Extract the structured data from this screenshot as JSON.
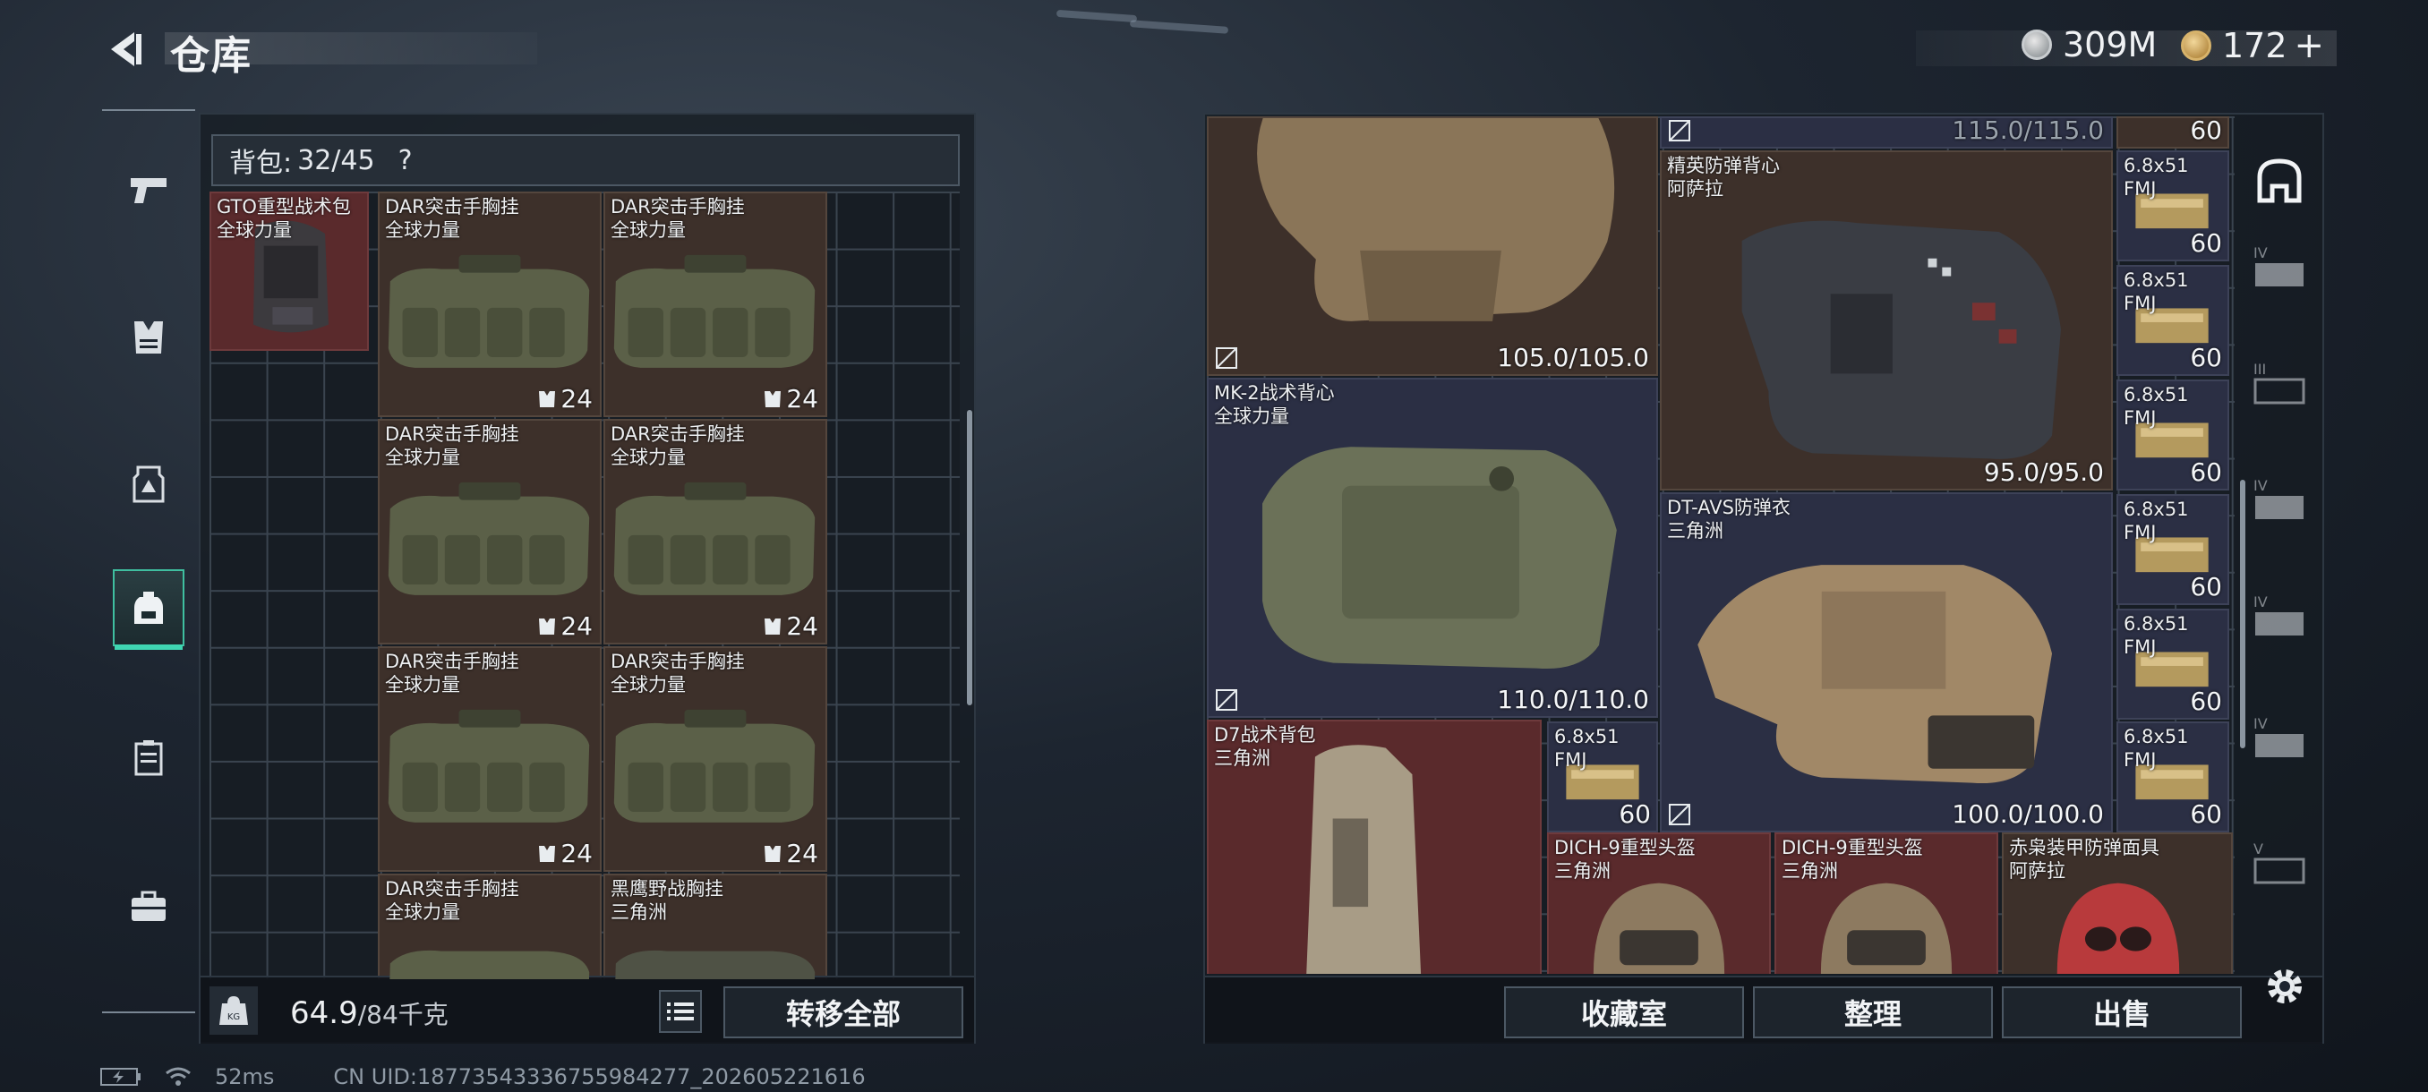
{
  "header": {
    "title": "仓库"
  },
  "currency": {
    "silver": "309M",
    "gold": "172",
    "gold_add": "+"
  },
  "backpack": {
    "label": "背包:",
    "capacity": "32/45",
    "help": "?",
    "items": [
      {
        "name1": "GTO重型战术包",
        "name2": "全球力量",
        "stat": ""
      },
      {
        "name1": "DAR突击手胸挂",
        "name2": "全球力量",
        "stat": "24"
      },
      {
        "name1": "DAR突击手胸挂",
        "name2": "全球力量",
        "stat": "24"
      },
      {
        "name1": "DAR突击手胸挂",
        "name2": "全球力量",
        "stat": "24"
      },
      {
        "name1": "DAR突击手胸挂",
        "name2": "全球力量",
        "stat": "24"
      },
      {
        "name1": "DAR突击手胸挂",
        "name2": "全球力量",
        "stat": "24"
      },
      {
        "name1": "DAR突击手胸挂",
        "name2": "全球力量",
        "stat": "24"
      },
      {
        "name1": "DAR突击手胸挂",
        "name2": "全球力量",
        "stat": ""
      },
      {
        "name1": "黑鹰野战胸挂",
        "name2": "三角洲",
        "stat": ""
      }
    ],
    "weight_current": "64.9",
    "weight_capacity": "/84千克",
    "transfer_label": "转移全部"
  },
  "storage": {
    "items": [
      {
        "name1": "",
        "name2": "",
        "stat": "105.0/105.0"
      },
      {
        "name1": "",
        "name2": "",
        "stat": "115.0/115.0"
      },
      {
        "name1": "精英防弹背心",
        "name2": "阿萨拉",
        "stat": "95.0/95.0"
      },
      {
        "name1": "MK-2战术背心",
        "name2": "全球力量",
        "stat": "110.0/110.0"
      },
      {
        "name1": "DT-AVS防弹衣",
        "name2": "三角洲",
        "stat": "100.0/100.0"
      },
      {
        "name1": "D7战术背包",
        "name2": "三角洲",
        "stat": ""
      },
      {
        "name1": "DICH-9重型头盔",
        "name2": "三角洲",
        "stat": ""
      },
      {
        "name1": "DICH-9重型头盔",
        "name2": "三角洲",
        "stat": ""
      },
      {
        "name1": "赤枭装甲防弹面具",
        "name2": "阿萨拉",
        "stat": ""
      }
    ],
    "ammo": [
      {
        "name1": "",
        "name2": "",
        "count": "60"
      },
      {
        "name1": "6.8x51",
        "name2": "FMJ",
        "count": "60"
      },
      {
        "name1": "6.8x51",
        "name2": "FMJ",
        "count": "60"
      },
      {
        "name1": "6.8x51",
        "name2": "FMJ",
        "count": "60"
      },
      {
        "name1": "6.8x51",
        "name2": "FMJ",
        "count": "60"
      },
      {
        "name1": "6.8x51",
        "name2": "FMJ",
        "count": "60"
      },
      {
        "name1": "6.8x51",
        "name2": "FMJ",
        "count": "60"
      },
      {
        "name1": "6.8x51",
        "name2": "FMJ",
        "count": "60"
      }
    ],
    "buttons": {
      "collection": "收藏室",
      "sort": "整理",
      "sell": "出售"
    }
  },
  "status": {
    "ping": "52ms",
    "uid": "CN UID:18773543336755984277_202605221616"
  },
  "colors": {
    "accent": "#3fd6b2",
    "red_cell": "#5a2a2c",
    "navy_cell": "#2b2f44",
    "brown_cell": "#3d302a"
  }
}
